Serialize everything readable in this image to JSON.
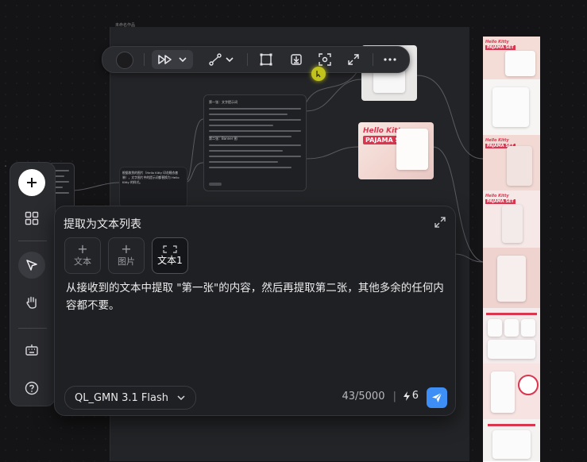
{
  "canvas": {
    "title": "未命名作品"
  },
  "toolbar": {
    "items": [
      "color-swatch",
      "fast-forward-icon",
      "chevron-down-icon",
      "curve-icon",
      "chevron-down-icon",
      "frame-icon",
      "download-icon",
      "scan-icon",
      "expand-icon",
      "more-icon"
    ]
  },
  "nodes": {
    "text_node_a": {
      "heading": "第一张：文字提示词",
      "sub": "第二张：Banner 图"
    },
    "text_node_b": {
      "line1": "根据收到的图片（Hello Kitty 印花睡衣套装），文字图片中的提示词都替换为 Hello Kitty 的样式。"
    }
  },
  "image_cards": {
    "logo": "Hello Kitty",
    "title": "PAJAMA SET"
  },
  "left_panel": {
    "buttons": [
      "add-icon",
      "grid-icon",
      "pointer-icon",
      "hand-icon",
      "keyboard-icon",
      "help-icon"
    ]
  },
  "dialog": {
    "title": "提取为文本列表",
    "attachments": [
      {
        "label": "文本"
      },
      {
        "label": "图片"
      },
      {
        "label": "文本1"
      }
    ],
    "prompt": "从接收到的文本中提取 \"第一张\"的内容，然后再提取第二张，其他多余的任何内容都不要。",
    "model": "QL_GMN 3.1 Flash",
    "char_count": "43/5000",
    "separator": "|",
    "cost": "6"
  },
  "colors": {
    "accent": "#3d8ff6",
    "cursor": "#c2c21c",
    "brand_red": "#d9364f"
  }
}
